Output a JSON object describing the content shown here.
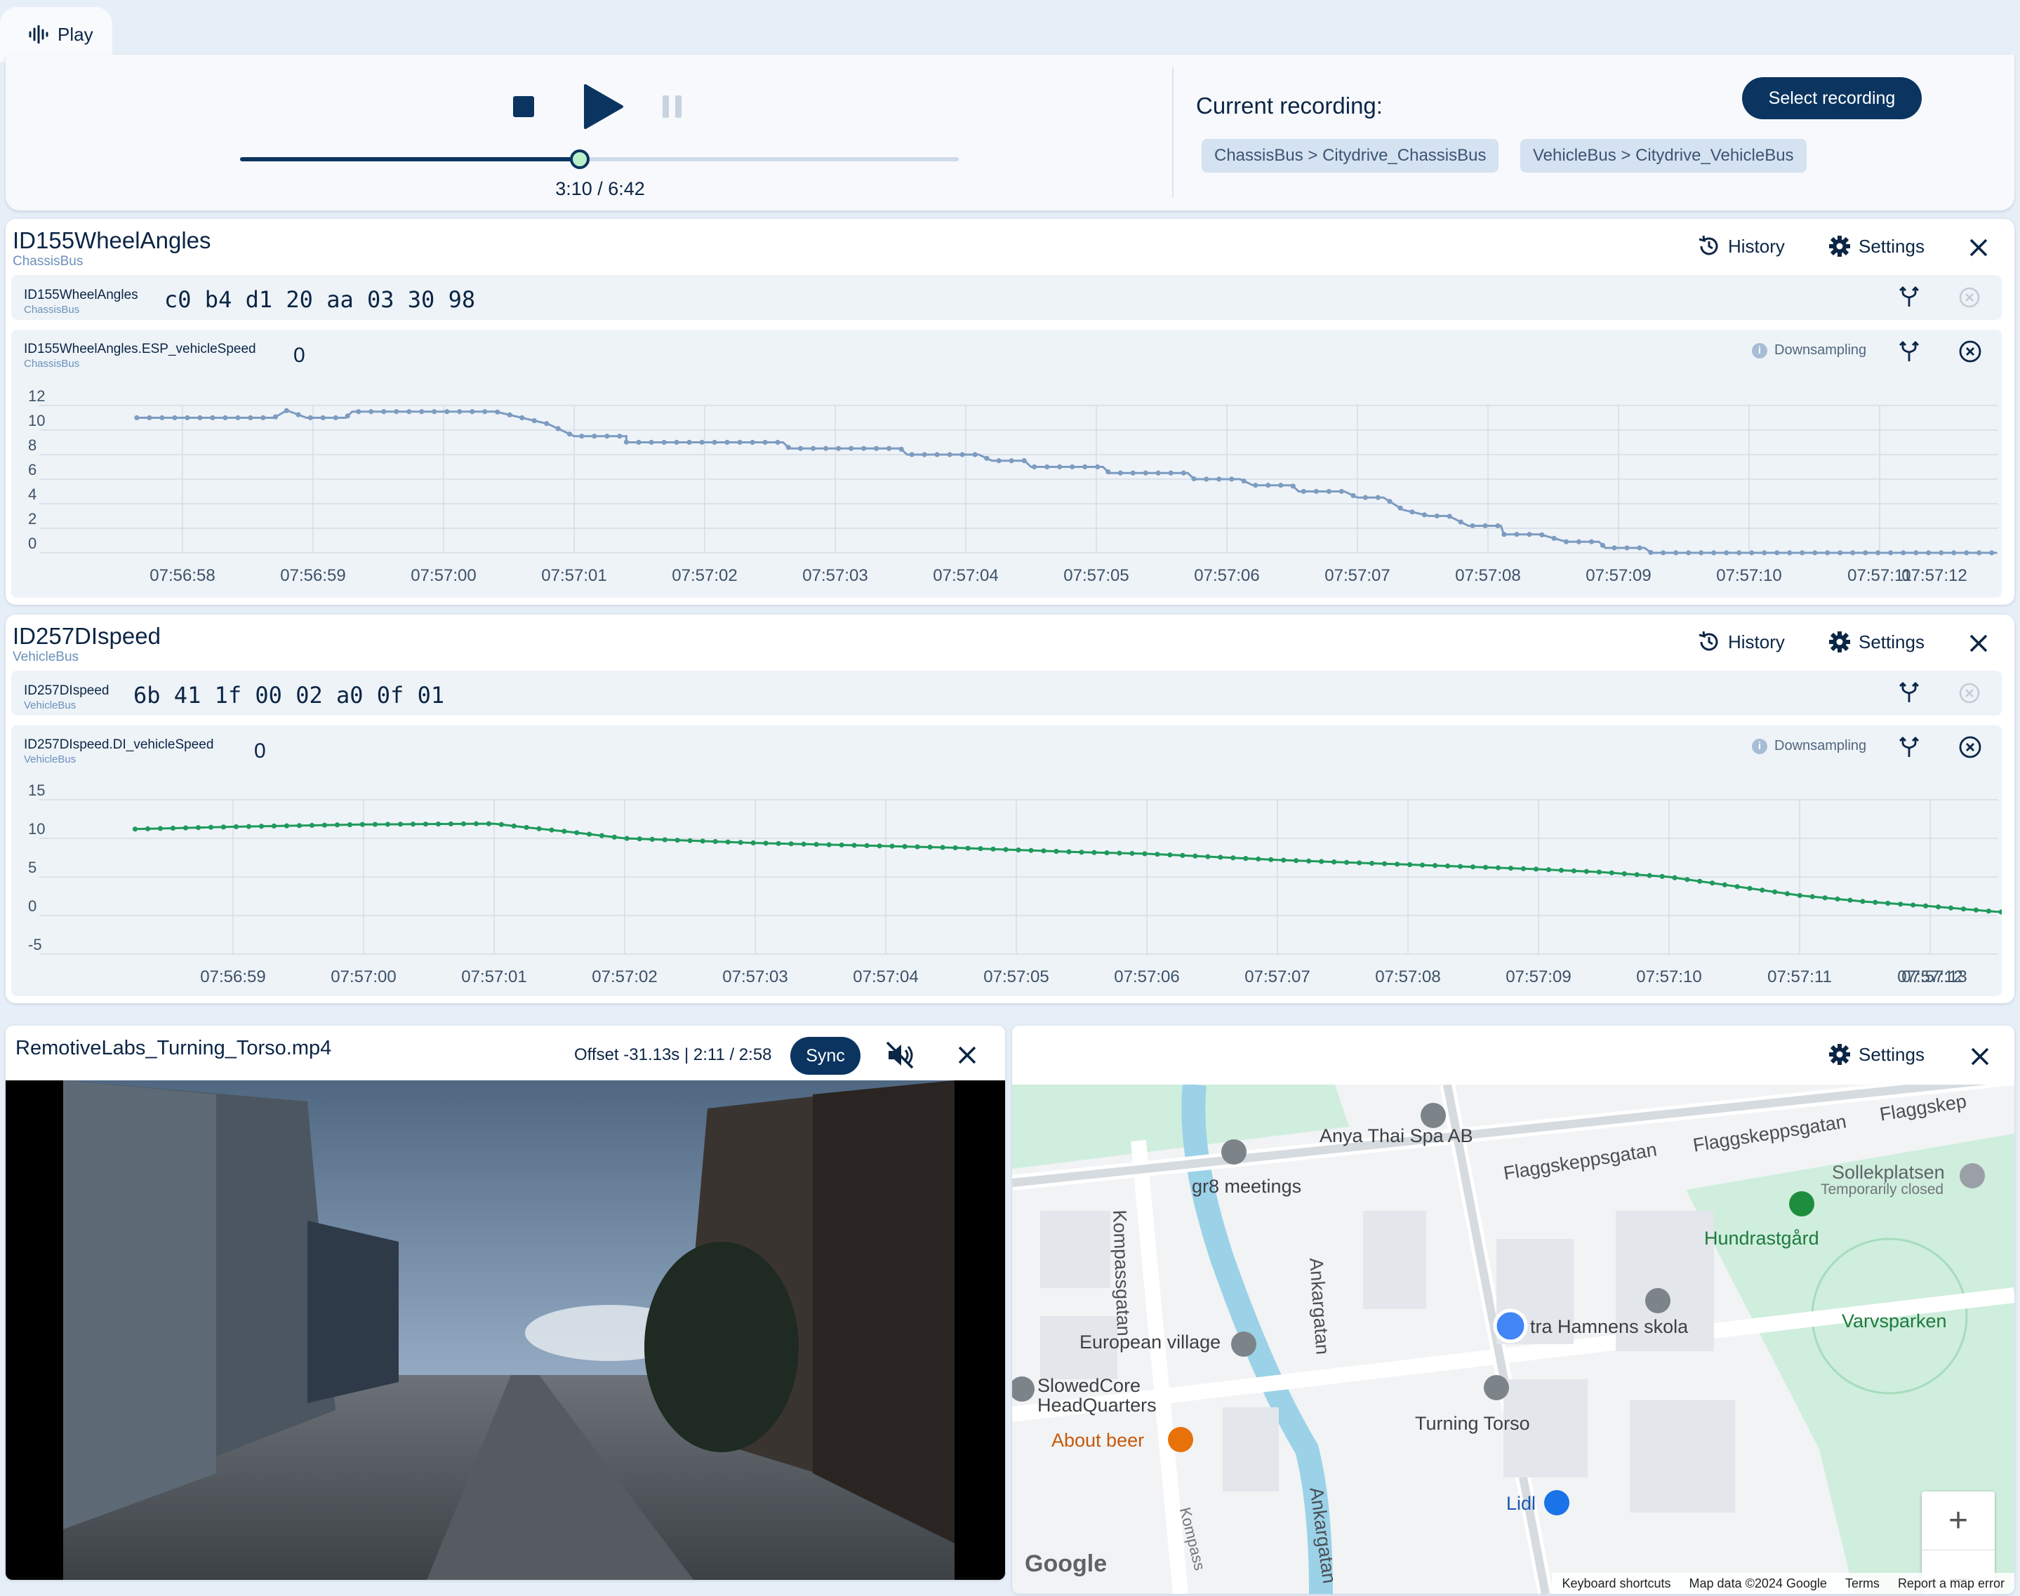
{
  "tab": {
    "label": "Play",
    "icon": "waveform-icon"
  },
  "player": {
    "time_label": "3:10 / 6:42",
    "progress": 0.4726,
    "icons": {
      "stop": "stop-icon",
      "play": "play-icon",
      "pause": "pause-icon"
    }
  },
  "recording": {
    "label": "Current recording:",
    "select_button": "Select recording",
    "chips": [
      "ChassisBus > Citydrive_ChassisBus",
      "VehicleBus > Citydrive_VehicleBus"
    ]
  },
  "colors": {
    "accent": "#0b3560",
    "series1": "#7d9cc0",
    "series2": "#1f9a5c",
    "user_dot": "#4285f4"
  },
  "panels": [
    {
      "title": "ID155WheelAngles",
      "bus": "ChassisBus",
      "history": "History",
      "settings": "Settings",
      "frame": {
        "name": "ID155WheelAngles",
        "bus": "ChassisBus",
        "hex": "c0 b4 d1 20 aa 03 30 98"
      },
      "signal": {
        "name": "ID155WheelAngles.ESP_vehicleSpeed",
        "bus": "ChassisBus",
        "value": "0",
        "downsampling": "Downsampling"
      }
    },
    {
      "title": "ID257DIspeed",
      "bus": "VehicleBus",
      "history": "History",
      "settings": "Settings",
      "frame": {
        "name": "ID257DIspeed",
        "bus": "VehicleBus",
        "hex": "6b 41 1f 00 02 a0 0f 01"
      },
      "signal": {
        "name": "ID257DIspeed.DI_vehicleSpeed",
        "bus": "VehicleBus",
        "value": "0",
        "downsampling": "Downsampling"
      }
    }
  ],
  "chart_data": [
    {
      "type": "line",
      "title": "",
      "series": [
        {
          "name": "ID155WheelAngles.ESP_vehicleSpeed"
        }
      ],
      "y_ticks": [
        12,
        10,
        8,
        6,
        4,
        2,
        0
      ],
      "ylim": [
        0,
        12
      ],
      "x_ticks": [
        "07:56:58",
        "07:56:59",
        "07:57:00",
        "07:57:01",
        "07:57:02",
        "07:57:03",
        "07:57:04",
        "07:57:05",
        "07:57:06",
        "07:57:07",
        "07:57:08",
        "07:57:09",
        "07:57:10",
        "07:57:11",
        "07:57:12"
      ],
      "points": [
        [
          -0.35,
          11.0
        ],
        [
          0.7,
          11.0
        ],
        [
          0.8,
          11.6
        ],
        [
          0.95,
          11.0
        ],
        [
          1.25,
          11.0
        ],
        [
          1.3,
          11.5
        ],
        [
          2.4,
          11.5
        ],
        [
          2.6,
          11.0
        ],
        [
          2.8,
          10.5
        ],
        [
          3.0,
          9.5
        ],
        [
          3.4,
          9.5
        ],
        [
          3.4,
          9.0
        ],
        [
          4.6,
          9.0
        ],
        [
          4.65,
          8.5
        ],
        [
          5.5,
          8.5
        ],
        [
          5.55,
          8.0
        ],
        [
          6.1,
          8.0
        ],
        [
          6.2,
          7.5
        ],
        [
          6.45,
          7.5
        ],
        [
          6.5,
          7.0
        ],
        [
          7.05,
          7.0
        ],
        [
          7.1,
          6.5
        ],
        [
          7.7,
          6.5
        ],
        [
          7.75,
          6.0
        ],
        [
          8.1,
          6.0
        ],
        [
          8.2,
          5.5
        ],
        [
          8.5,
          5.5
        ],
        [
          8.55,
          5.0
        ],
        [
          8.9,
          5.0
        ],
        [
          9.0,
          4.5
        ],
        [
          9.2,
          4.5
        ],
        [
          9.35,
          3.5
        ],
        [
          9.55,
          3.0
        ],
        [
          9.7,
          3.0
        ],
        [
          9.85,
          2.2
        ],
        [
          10.1,
          2.2
        ],
        [
          10.12,
          1.5
        ],
        [
          10.4,
          1.5
        ],
        [
          10.6,
          0.9
        ],
        [
          10.85,
          0.9
        ],
        [
          10.9,
          0.4
        ],
        [
          11.2,
          0.4
        ],
        [
          11.25,
          0.0
        ],
        [
          13.9,
          0.0
        ]
      ]
    },
    {
      "type": "line",
      "title": "",
      "series": [
        {
          "name": "ID257DIspeed.DI_vehicleSpeed"
        }
      ],
      "y_ticks": [
        15,
        10,
        5,
        0,
        -5
      ],
      "ylim": [
        -5,
        15
      ],
      "x_ticks": [
        "07:56:59",
        "07:57:00",
        "07:57:01",
        "07:57:02",
        "07:57:03",
        "07:57:04",
        "07:57:05",
        "07:57:06",
        "07:57:07",
        "07:57:08",
        "07:57:09",
        "07:57:10",
        "07:57:11",
        "07:57:12",
        "07:57:13"
      ],
      "points": [
        [
          -0.75,
          11.2
        ],
        [
          0.0,
          11.5
        ],
        [
          1.0,
          11.8
        ],
        [
          2.0,
          11.9
        ],
        [
          2.2,
          11.5
        ],
        [
          2.6,
          10.8
        ],
        [
          3.0,
          10.0
        ],
        [
          3.5,
          9.7
        ],
        [
          4.0,
          9.4
        ],
        [
          4.5,
          9.2
        ],
        [
          5.0,
          9.0
        ],
        [
          5.5,
          8.8
        ],
        [
          6.0,
          8.5
        ],
        [
          6.5,
          8.2
        ],
        [
          7.0,
          8.0
        ],
        [
          7.5,
          7.6
        ],
        [
          8.0,
          7.2
        ],
        [
          8.5,
          6.9
        ],
        [
          9.0,
          6.6
        ],
        [
          9.5,
          6.3
        ],
        [
          10.0,
          6.0
        ],
        [
          10.5,
          5.6
        ],
        [
          11.0,
          5.0
        ],
        [
          11.5,
          3.8
        ],
        [
          12.0,
          2.6
        ],
        [
          12.5,
          1.8
        ],
        [
          13.0,
          1.2
        ],
        [
          13.5,
          0.5
        ],
        [
          14.0,
          0.0
        ],
        [
          16.3,
          0.0
        ]
      ]
    }
  ],
  "video": {
    "title": "RemotiveLabs_Turning_Torso.mp4",
    "offset": "Offset -31.13s | 2:11 / 2:58",
    "sync": "Sync",
    "mute_icon": "speaker-muted-icon",
    "close_icon": "close-icon"
  },
  "map": {
    "settings": "Settings",
    "places": {
      "anya": "Anya Thai Spa AB",
      "gr8": "gr8 meetings",
      "flagg1": "Flaggskeppsgatan",
      "flagg2": "Flaggskeppsgatan",
      "flagg3": "Flaggskep",
      "sollek": "Sollekplatsen",
      "sollek_sub": "Temporarily closed",
      "hundrast": "Hundrastgård",
      "kompass": "Kompassgatan",
      "ankar": "Ankargatan",
      "ankar2": "Ankargatan",
      "kompass2": "Kompass",
      "european": "European village",
      "slowed": "SlowedCore",
      "hq": "HeadQuarters",
      "about_beer": "About beer",
      "turning": "Turning Torso",
      "lidl": "Lidl",
      "skola": "tra Hamnens skola",
      "varvsparken": "Varvsparken"
    },
    "footer": [
      "Keyboard shortcuts",
      "Map data ©2024 Google",
      "Terms",
      "Report a map error"
    ],
    "logo": "Google",
    "zoom_in": "+",
    "zoom_out": "−"
  }
}
